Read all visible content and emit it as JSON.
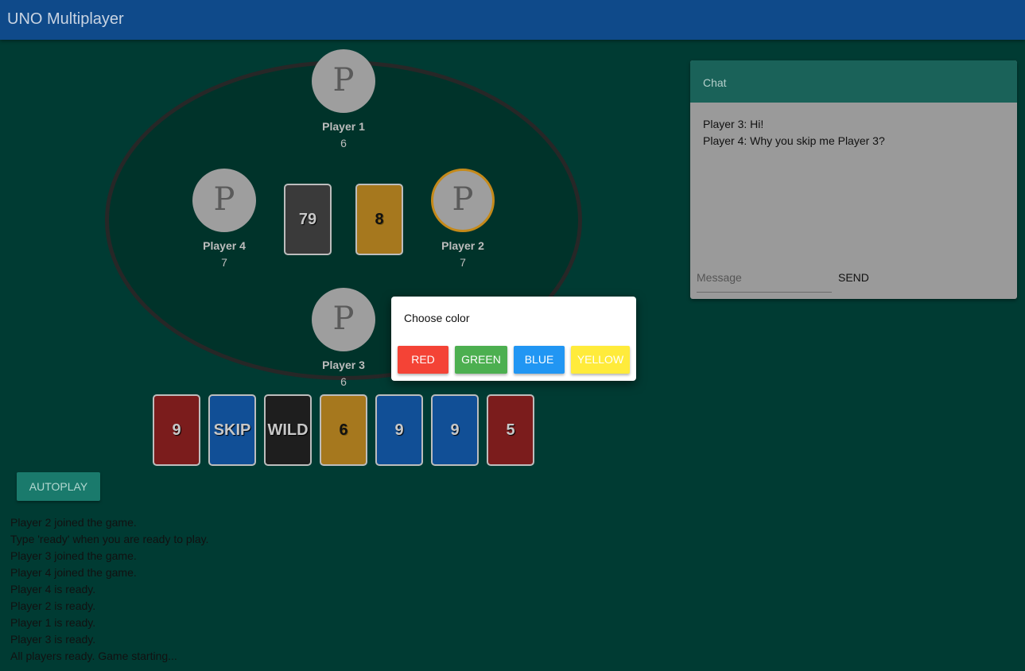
{
  "app": {
    "title": "UNO Multiplayer"
  },
  "players": [
    {
      "avatar": "P",
      "name": "Player 1",
      "cards": "6"
    },
    {
      "avatar": "P",
      "name": "Player 2",
      "cards": "7"
    },
    {
      "avatar": "P",
      "name": "Player 3",
      "cards": "6"
    },
    {
      "avatar": "P",
      "name": "Player 4",
      "cards": "7"
    }
  ],
  "deck": {
    "count": "79"
  },
  "discard": {
    "value": "8",
    "color": "#a6781e"
  },
  "hand": [
    {
      "value": "9",
      "color": "#7b1c1c"
    },
    {
      "value": "SKIP",
      "color": "#114f96"
    },
    {
      "value": "WILD",
      "color": "#1e1e1e"
    },
    {
      "value": "6",
      "color": "#a6781e"
    },
    {
      "value": "9",
      "color": "#114f96"
    },
    {
      "value": "9",
      "color": "#114f96"
    },
    {
      "value": "5",
      "color": "#7b1c1c"
    }
  ],
  "dialog": {
    "title": "Choose color",
    "buttons": [
      {
        "label": "RED",
        "color": "#f44336"
      },
      {
        "label": "GREEN",
        "color": "#4caf50"
      },
      {
        "label": "BLUE",
        "color": "#2196f3"
      },
      {
        "label": "YELLOW",
        "color": "#ffeb3b"
      }
    ]
  },
  "chat": {
    "title": "Chat",
    "messages": [
      "Player 3: Hi!",
      "Player 4: Why you skip me Player 3?"
    ],
    "placeholder": "Message",
    "send_label": "SEND"
  },
  "autoplay_label": "AUTOPLAY",
  "log": [
    "Player 2 joined the game.",
    "Type 'ready' when you are ready to play.",
    "Player 3 joined the game.",
    "Player 4 joined the game.",
    "Player 4 is ready.",
    "Player 2 is ready.",
    "Player 1 is ready.",
    "Player 3 is ready.",
    "All players ready. Game starting..."
  ]
}
